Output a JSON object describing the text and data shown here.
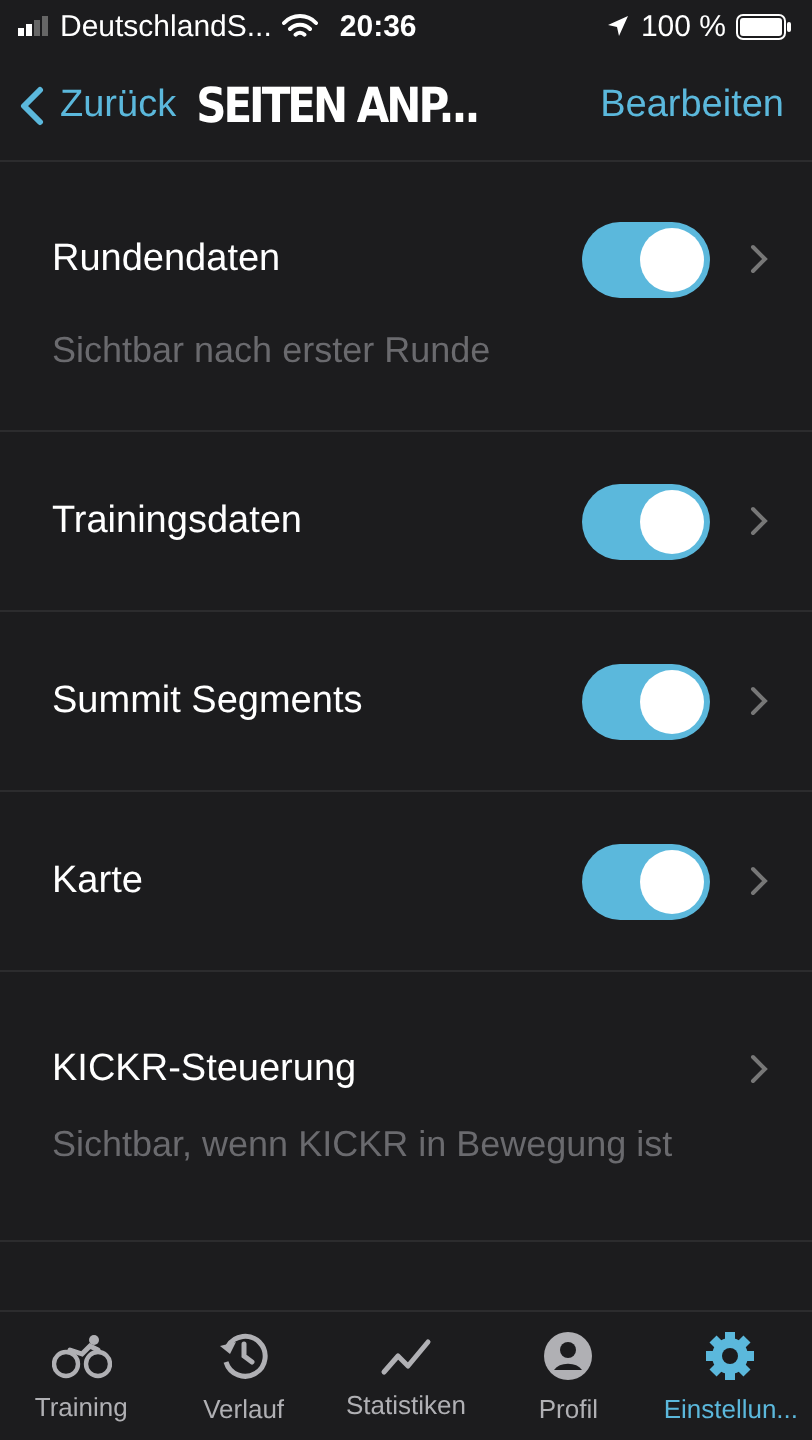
{
  "status_bar": {
    "carrier": "DeutschlandS...",
    "time": "20:36",
    "battery": "100 %"
  },
  "nav": {
    "back": "Zurück",
    "title": "SEITEN ANP...",
    "action": "Bearbeiten"
  },
  "rows": [
    {
      "kind": "toggle",
      "label": "Rundendaten",
      "on": true,
      "note": "Sichtbar nach erster Runde"
    },
    {
      "kind": "toggle",
      "label": "Trainingsdaten",
      "on": true
    },
    {
      "kind": "toggle",
      "label": "Summit Segments",
      "on": true
    },
    {
      "kind": "toggle",
      "label": "Karte",
      "on": true
    },
    {
      "kind": "link",
      "label": "KICKR-Steuerung",
      "note": "Sichtbar, wenn KICKR in Bewegung ist"
    }
  ],
  "tabs": [
    {
      "label": "Training",
      "selected": false
    },
    {
      "label": "Verlauf",
      "selected": false
    },
    {
      "label": "Statistiken",
      "selected": false
    },
    {
      "label": "Profil",
      "selected": false
    },
    {
      "label": "Einstellun...",
      "selected": true
    }
  ]
}
